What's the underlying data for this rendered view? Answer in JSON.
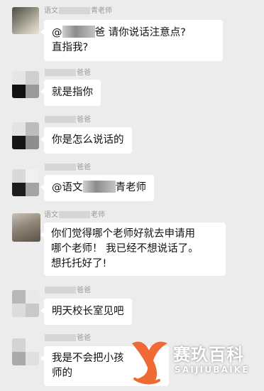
{
  "messages": [
    {
      "sender_prefix": "语文",
      "sender_suffix": "青老师",
      "text_prefix": "@",
      "text_line1": "爸 请你说话注意点?",
      "text_line2": "直指我?"
    },
    {
      "sender_suffix": "爸爸",
      "text": "就是指你"
    },
    {
      "sender_suffix": "爸爸",
      "text": "你是怎么说话的"
    },
    {
      "sender_suffix": "爸爸",
      "text_prefix": "@语文",
      "text_suffix": "青老师"
    },
    {
      "sender_prefix": "语文",
      "sender_suffix": "老师",
      "text_line1": "你们觉得哪个老师好就去申请用",
      "text_line2": "哪个老师！ 我已经不想说话了。",
      "text_line3": "想托托好了!"
    },
    {
      "sender_suffix": "爸爸",
      "text": "明天校长室见吧"
    },
    {
      "sender_suffix": "爸爸",
      "text_line1": "我是不会把小孩",
      "text_line2": "师的"
    }
  ],
  "watermark": {
    "title": "赛玖百科",
    "subtitle": "SAIJIUBAIKE",
    "color": "#f06a35"
  },
  "colors": {
    "background": "#ececec",
    "bubble": "#ffffff",
    "sender_text": "#9a9a9a"
  }
}
